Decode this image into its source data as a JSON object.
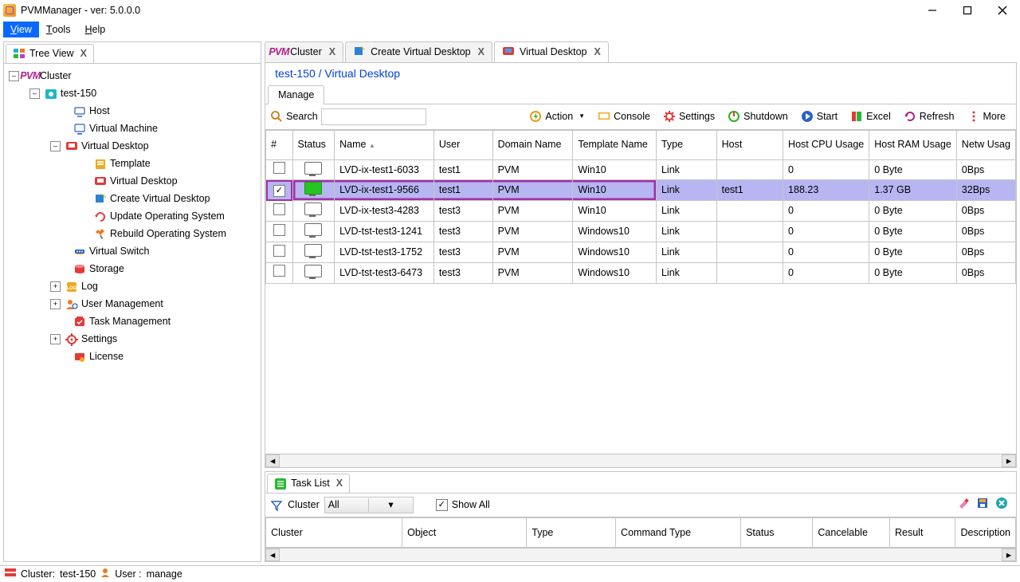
{
  "window": {
    "title": "PVMManager - ver: 5.0.0.0"
  },
  "menubar": {
    "view": "View",
    "tools": "Tools",
    "help": "Help"
  },
  "left": {
    "tab_label": "Tree View",
    "tree": {
      "cluster": "Cluster",
      "host_node": "test-150",
      "items": {
        "host": "Host",
        "vm": "Virtual Machine",
        "vd": "Virtual Desktop",
        "vd_children": {
          "template": "Template",
          "vd2": "Virtual Desktop",
          "create_vd": "Create Virtual Desktop",
          "update_os": "Update Operating System",
          "rebuild_os": "Rebuild Operating System"
        },
        "vswitch": "Virtual Switch",
        "storage": "Storage",
        "log": "Log",
        "user_mgmt": "User Management",
        "task_mgmt": "Task Management",
        "settings": "Settings",
        "license": "License"
      }
    }
  },
  "main_tabs": {
    "cluster": "Cluster",
    "create_vd": "Create Virtual Desktop",
    "vd": "Virtual Desktop"
  },
  "breadcrumb": "test-150 / Virtual Desktop",
  "subtab": {
    "manage": "Manage"
  },
  "toolbar": {
    "search": "Search",
    "action": "Action",
    "console": "Console",
    "settings": "Settings",
    "shutdown": "Shutdown",
    "start": "Start",
    "excel": "Excel",
    "refresh": "Refresh",
    "more": "More"
  },
  "grid": {
    "headers": {
      "chk": "#",
      "status": "Status",
      "name": "Name",
      "user": "User",
      "domain": "Domain Name",
      "template": "Template Name",
      "type": "Type",
      "host": "Host",
      "hcpu": "Host CPU Usage",
      "hram": "Host RAM Usage",
      "net": "Netw Usag"
    },
    "rows": [
      {
        "chk": false,
        "on": false,
        "name": "LVD-ix-test1-6033",
        "user": "test1",
        "domain": "PVM",
        "template": "Win10",
        "type": "Link",
        "host": "",
        "hcpu": "0",
        "hram": "0 Byte",
        "net": "0Bps"
      },
      {
        "chk": true,
        "on": true,
        "name": "LVD-ix-test1-9566",
        "user": "test1",
        "domain": "PVM",
        "template": "Win10",
        "type": "Link",
        "host": "test1",
        "hcpu": "188.23",
        "hram": "1.37 GB",
        "net": "32Bps"
      },
      {
        "chk": false,
        "on": false,
        "name": "LVD-ix-test3-4283",
        "user": "test3",
        "domain": "PVM",
        "template": "Win10",
        "type": "Link",
        "host": "",
        "hcpu": "0",
        "hram": "0 Byte",
        "net": "0Bps"
      },
      {
        "chk": false,
        "on": false,
        "name": "LVD-tst-test3-1241",
        "user": "test3",
        "domain": "PVM",
        "template": "Windows10",
        "type": "Link",
        "host": "",
        "hcpu": "0",
        "hram": "0 Byte",
        "net": "0Bps"
      },
      {
        "chk": false,
        "on": false,
        "name": "LVD-tst-test3-1752",
        "user": "test3",
        "domain": "PVM",
        "template": "Windows10",
        "type": "Link",
        "host": "",
        "hcpu": "0",
        "hram": "0 Byte",
        "net": "0Bps"
      },
      {
        "chk": false,
        "on": false,
        "name": "LVD-tst-test3-6473",
        "user": "test3",
        "domain": "PVM",
        "template": "Windows10",
        "type": "Link",
        "host": "",
        "hcpu": "0",
        "hram": "0 Byte",
        "net": "0Bps"
      }
    ]
  },
  "task": {
    "tab": "Task List",
    "filter_label": "Cluster",
    "filter_value": "All",
    "showall": "Show All",
    "headers": {
      "cluster": "Cluster",
      "object": "Object",
      "type": "Type",
      "cmdtype": "Command Type",
      "status": "Status",
      "cancelable": "Cancelable",
      "result": "Result",
      "desc": "Description"
    }
  },
  "statusbar": {
    "cluster_lbl": "Cluster:",
    "cluster_val": "test-150",
    "user_lbl": "User :",
    "user_val": "manage"
  }
}
